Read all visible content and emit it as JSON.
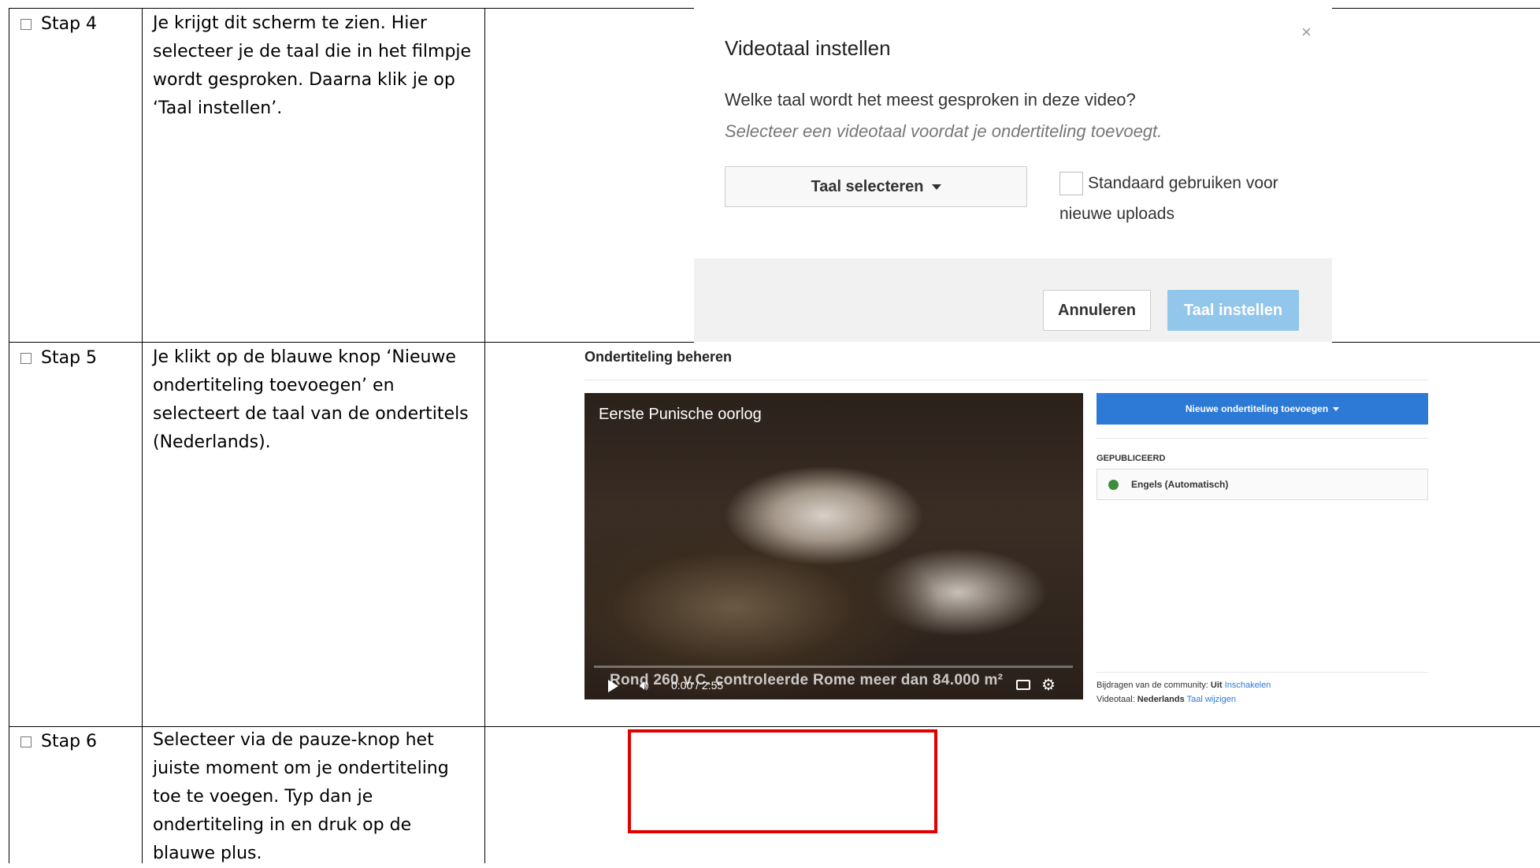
{
  "steps": [
    {
      "label": "Stap 4",
      "text": "Je krijgt dit scherm te zien. Hier selecteer je de taal die in het filmpje wordt gesproken. Daarna klik je op ‘Taal instellen’."
    },
    {
      "label": "Stap 5",
      "text": "Je klikt op de blauwe knop ‘Nieuwe ondertiteling toevoegen’ en selecteert de taal van de ondertitels (Nederlands)."
    },
    {
      "label": "Stap 6",
      "text": "Selecteer via de pauze-knop het juiste moment om je ondertiteling toe te voegen. Typ dan je ondertiteling in en druk op de blauwe plus."
    }
  ],
  "dialog": {
    "title": "Videotaal instellen",
    "close": "×",
    "question": "Welke taal wordt het meest gesproken in deze video?",
    "hint": "Selecteer een videotaal voordat je ondertiteling toevoegt.",
    "select_label": "Taal selecteren",
    "checkbox_label_line1": "Standaard gebruiken voor",
    "checkbox_label_line2": "nieuwe uploads",
    "cancel_label": "Annuleren",
    "submit_label": "Taal instellen"
  },
  "subtitles_panel": {
    "title": "Ondertiteling beheren",
    "video": {
      "title": "Eerste Punische oorlog",
      "caption": "Rond 260 v.C. controleerde Rome meer dan 84.000 m²",
      "time": "0:00 / 2:55",
      "progress": 0
    },
    "add_button": "Nieuwe ondertiteling toevoegen",
    "published_header": "GEPUBLICEERD",
    "track_label": "Engels (Automatisch)",
    "community_label": "Bijdragen van de community:",
    "community_value": "Uit",
    "community_link": "Inschakelen",
    "videolang_label": "Videotaal:",
    "videolang_value": "Nederlands",
    "videolang_link": "Taal wijzigen"
  },
  "colors": {
    "primary_blue": "#2d7ad6",
    "disabled_blue": "#93c6eb",
    "highlight_red": "#e00000",
    "published_green": "#3c8c3c"
  }
}
